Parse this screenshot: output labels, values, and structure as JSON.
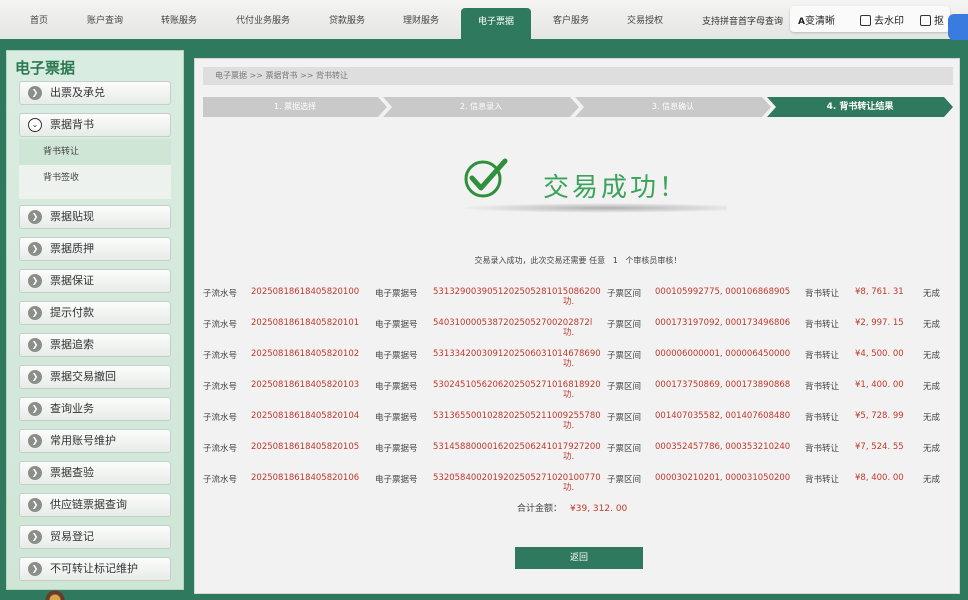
{
  "nav": {
    "tabs": [
      "首页",
      "账户查询",
      "转账服务",
      "代付业务服务",
      "贷款服务",
      "理财服务",
      "电子票据",
      "客户服务",
      "交易授权"
    ],
    "active_index": 6,
    "search_text": "支持拼音首字母查询",
    "ext": {
      "translate": "变清晰",
      "watermark": "去水印",
      "third": "抠"
    }
  },
  "sidebar": {
    "title": "电子票据",
    "items": [
      "出票及承兑",
      "票据背书",
      "票据贴现",
      "票据质押",
      "票据保证",
      "提示付款",
      "票据追索",
      "票据交易撤回",
      "查询业务",
      "常用账号维护",
      "票据查验",
      "供应链票据查询",
      "贸易登记",
      "不可转让标记维护"
    ],
    "open_index": 1,
    "sub_items": [
      "背书转让",
      "背书签收"
    ],
    "sub_active_index": 0
  },
  "main": {
    "breadcrumb": "电子票据 >> 票据背书 >> 背书转让",
    "steps": [
      "1. 票据选择",
      "2. 信息录入",
      "3. 信息确认",
      "4. 背书转让结果"
    ],
    "active_step": 3,
    "success_title": "交易成功！",
    "message": "交易录入成功，此次交易还需要 任意   1   个审核员审核！",
    "labels": {
      "serial": "子流水号",
      "bill": "电子票据号",
      "range": "子票区间",
      "type": "背书转让",
      "status": "无成"
    },
    "records": [
      {
        "serial": "20250818618405820100",
        "bill": "5313290039051202505281015086200",
        "bill_tail": "功.",
        "range": "000105992775, 000106868905",
        "amount": "¥8, 761. 31"
      },
      {
        "serial": "20250818618405820101",
        "bill": "54031000053872025052700202872l",
        "bill_tail": "功.",
        "range": "000173197092, 000173496806",
        "amount": "¥2, 997. 15"
      },
      {
        "serial": "20250818618405820102",
        "bill": "5313342003091202506031014678690",
        "bill_tail": "功.",
        "range": "000006000001, 000006450000",
        "amount": "¥4, 500. 00"
      },
      {
        "serial": "20250818618405820103",
        "bill": "5302451056206202505271016818920",
        "bill_tail": "功.",
        "range": "000173750869, 000173890868",
        "amount": "¥1, 400. 00"
      },
      {
        "serial": "20250818618405820104",
        "bill": "5313655001028202505211009255780",
        "bill_tail": "功.",
        "range": "001407035582, 001407608480",
        "amount": "¥5, 728. 99"
      },
      {
        "serial": "20250818618405820105",
        "bill": "5314588000016202506241017927200",
        "bill_tail": "功.",
        "range": "000352457786, 000353210240",
        "amount": "¥7, 524. 55"
      },
      {
        "serial": "20250818618405820106",
        "bill": "5320584002019202505271020100770",
        "bill_tail": "功.",
        "range": "000030210201, 000031050200",
        "amount": "¥8, 400. 00"
      }
    ],
    "total_label": "合计金额：",
    "total_value": "¥39, 312. 00",
    "back_label": "返回"
  }
}
